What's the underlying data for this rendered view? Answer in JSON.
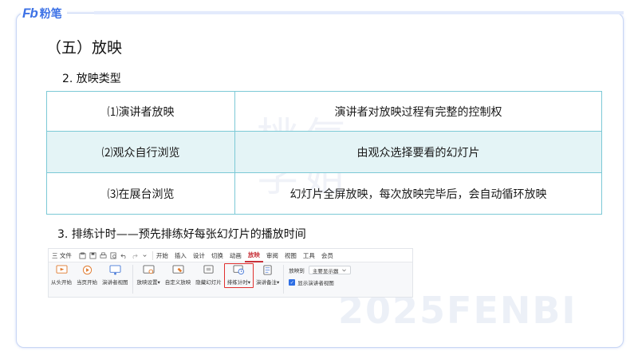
{
  "logo": {
    "fb": "Fb",
    "name": "粉笔"
  },
  "watermark": {
    "line1": "桃气",
    "line2": "学姐",
    "code": "2025FENBI"
  },
  "section_title": "（五）放映",
  "subsection2": "2.  放映类型",
  "table": {
    "rows": [
      {
        "type": "⑴演讲者放映",
        "desc": "演讲者对放映过程有完整的控制权"
      },
      {
        "type": "⑵观众自行浏览",
        "desc": "由观众选择要看的幻灯片"
      },
      {
        "type": "⑶在展台浏览",
        "desc": "幻灯片全屏放映，每次放映完毕后，会自动循环放映"
      }
    ]
  },
  "subsection3": "3.  排练计时——预先排练好每张幻灯片的播放时间",
  "ribbon": {
    "file_menu": "三 文件",
    "tabs": [
      "开始",
      "插入",
      "设计",
      "切换",
      "动画",
      "放映",
      "审阅",
      "视图",
      "工具",
      "会员"
    ],
    "active_tab": "放映",
    "tools": [
      "从头开始",
      "当页开始",
      "演讲者视图",
      "放映设置▾",
      "自定义放映",
      "隐藏幻灯片",
      "排练计时▾",
      "演讲备注▾"
    ],
    "highlighted_tool": "排练计时▾",
    "show_on_label": "放映到",
    "show_on_value": "主要显示器",
    "presenter_view_checkbox": "显示演讲者视图",
    "accent_color": "#c8323a",
    "highlight_color": "#e0302e"
  }
}
